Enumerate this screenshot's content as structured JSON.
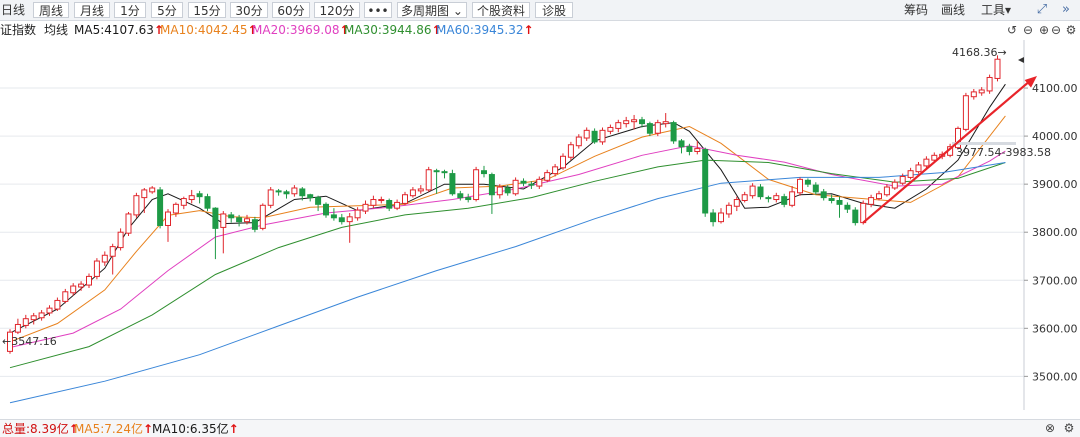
{
  "toolbar": {
    "period_buttons": [
      "日线",
      "周线",
      "月线",
      "1分",
      "5分",
      "15分",
      "30分",
      "60分",
      "120分"
    ],
    "more_label": "•••",
    "multi_period_label": "多周期图",
    "stock_info_label": "个股资料",
    "diagnose_label": "诊股",
    "right_buttons": [
      "筹码",
      "画线",
      "工具"
    ],
    "tools_caret": "▾"
  },
  "indicator_bar": {
    "index_name": "证指数",
    "avg_line_label": "均线",
    "ma": [
      {
        "label": "MA5:4107.63",
        "color": "#1a1a1a"
      },
      {
        "label": "MA10:4042.45",
        "color": "#e8821e"
      },
      {
        "label": "MA20:3969.08",
        "color": "#e040c0"
      },
      {
        "label": "MA30:3944.86",
        "color": "#2f8f2f"
      },
      {
        "label": "MA60:3945.32",
        "color": "#3a86d8"
      }
    ],
    "up_arrow": "↑"
  },
  "volume_bar": {
    "items": [
      {
        "label": "总量:8.39亿",
        "color": "#d01010"
      },
      {
        "label": "MA5:7.24亿",
        "color": "#e8821e"
      },
      {
        "label": "MA10:6.35亿",
        "color": "#1a1a1a"
      }
    ],
    "up_arrow": "↑"
  },
  "colors": {
    "up": "#e0262c",
    "down": "#1e9a46",
    "trend_arrow": "#e8242a",
    "grid": "#e6e9ee"
  },
  "chart_data": {
    "type": "candlestick",
    "y_axis": {
      "min": 3430,
      "max": 4200,
      "ticks": [
        3500,
        3600,
        3700,
        3800,
        3900,
        4000,
        4100
      ],
      "labels": [
        "3500.00",
        "3600.00",
        "3700.00",
        "3800.00",
        "3900.00",
        "4000.00",
        "4100.00"
      ]
    },
    "annotations": {
      "high_label": "4168.36→",
      "low_label": "←3547.16",
      "range_label": "3977.54-3983.58"
    },
    "candles": [
      [
        3552,
        3592,
        3547,
        3598
      ],
      [
        3592,
        3608,
        3588,
        3620
      ],
      [
        3606,
        3620,
        3600,
        3628
      ],
      [
        3618,
        3626,
        3608,
        3632
      ],
      [
        3622,
        3632,
        3616,
        3638
      ],
      [
        3632,
        3642,
        3626,
        3648
      ],
      [
        3640,
        3658,
        3636,
        3664
      ],
      [
        3656,
        3676,
        3652,
        3682
      ],
      [
        3674,
        3688,
        3668,
        3694
      ],
      [
        3686,
        3692,
        3678,
        3698
      ],
      [
        3690,
        3708,
        3684,
        3714
      ],
      [
        3708,
        3740,
        3702,
        3746
      ],
      [
        3738,
        3752,
        3730,
        3760
      ],
      [
        3750,
        3770,
        3712,
        3776
      ],
      [
        3768,
        3800,
        3762,
        3808
      ],
      [
        3798,
        3838,
        3792,
        3842
      ],
      [
        3836,
        3876,
        3830,
        3882
      ],
      [
        3872,
        3888,
        3840,
        3892
      ],
      [
        3884,
        3892,
        3880,
        3896
      ],
      [
        3888,
        3814,
        3808,
        3894
      ],
      [
        3814,
        3842,
        3780,
        3848
      ],
      [
        3840,
        3858,
        3832,
        3862
      ],
      [
        3856,
        3870,
        3848,
        3874
      ],
      [
        3868,
        3876,
        3860,
        3888
      ],
      [
        3880,
        3874,
        3860,
        3886
      ],
      [
        3874,
        3850,
        3844,
        3880
      ],
      [
        3850,
        3808,
        3744,
        3852
      ],
      [
        3810,
        3838,
        3756,
        3844
      ],
      [
        3836,
        3830,
        3820,
        3842
      ],
      [
        3830,
        3822,
        3812,
        3836
      ],
      [
        3822,
        3828,
        3816,
        3836
      ],
      [
        3826,
        3806,
        3800,
        3832
      ],
      [
        3808,
        3856,
        3804,
        3860
      ],
      [
        3856,
        3888,
        3850,
        3894
      ],
      [
        3886,
        3884,
        3876,
        3890
      ],
      [
        3884,
        3880,
        3870,
        3888
      ],
      [
        3880,
        3892,
        3874,
        3898
      ],
      [
        3890,
        3876,
        3866,
        3894
      ],
      [
        3878,
        3872,
        3864,
        3880
      ],
      [
        3872,
        3858,
        3844,
        3876
      ],
      [
        3858,
        3836,
        3830,
        3862
      ],
      [
        3836,
        3830,
        3824,
        3850
      ],
      [
        3830,
        3822,
        3816,
        3838
      ],
      [
        3822,
        3832,
        3778,
        3840
      ],
      [
        3830,
        3846,
        3824,
        3852
      ],
      [
        3844,
        3858,
        3838,
        3866
      ],
      [
        3856,
        3868,
        3850,
        3876
      ],
      [
        3866,
        3868,
        3860,
        3874
      ],
      [
        3866,
        3850,
        3844,
        3870
      ],
      [
        3850,
        3862,
        3846,
        3868
      ],
      [
        3860,
        3878,
        3856,
        3884
      ],
      [
        3876,
        3888,
        3872,
        3894
      ],
      [
        3886,
        3890,
        3880,
        3898
      ],
      [
        3888,
        3930,
        3884,
        3936
      ],
      [
        3928,
        3926,
        3880,
        3932
      ],
      [
        3926,
        3924,
        3912,
        3930
      ],
      [
        3922,
        3880,
        3876,
        3930
      ],
      [
        3880,
        3872,
        3866,
        3886
      ],
      [
        3872,
        3868,
        3862,
        3880
      ],
      [
        3868,
        3930,
        3864,
        3936
      ],
      [
        3928,
        3922,
        3914,
        3938
      ],
      [
        3920,
        3878,
        3838,
        3924
      ],
      [
        3878,
        3894,
        3870,
        3900
      ],
      [
        3892,
        3882,
        3876,
        3898
      ],
      [
        3880,
        3908,
        3876,
        3914
      ],
      [
        3906,
        3902,
        3896,
        3912
      ],
      [
        3900,
        3898,
        3890,
        3906
      ],
      [
        3896,
        3910,
        3890,
        3916
      ],
      [
        3908,
        3924,
        3904,
        3930
      ],
      [
        3922,
        3936,
        3916,
        3942
      ],
      [
        3934,
        3958,
        3930,
        3964
      ],
      [
        3956,
        3982,
        3950,
        3988
      ],
      [
        3980,
        3998,
        3974,
        4004
      ],
      [
        3996,
        4012,
        3990,
        4018
      ],
      [
        4010,
        3988,
        3984,
        4016
      ],
      [
        3988,
        4012,
        3982,
        4018
      ],
      [
        4010,
        4018,
        4004,
        4024
      ],
      [
        4016,
        4028,
        4008,
        4034
      ],
      [
        4026,
        4032,
        4018,
        4040
      ],
      [
        4030,
        4034,
        4014,
        4044
      ],
      [
        4034,
        4026,
        4018,
        4040
      ],
      [
        4026,
        4006,
        4000,
        4030
      ],
      [
        4006,
        4028,
        4000,
        4034
      ],
      [
        4026,
        4030,
        4018,
        4048
      ],
      [
        4028,
        3990,
        3984,
        4032
      ],
      [
        3990,
        3978,
        3964,
        3994
      ],
      [
        3978,
        3968,
        3960,
        3984
      ],
      [
        3968,
        3974,
        3962,
        3990
      ],
      [
        3972,
        3840,
        3832,
        3976
      ],
      [
        3840,
        3822,
        3812,
        3848
      ],
      [
        3822,
        3840,
        3818,
        3850
      ],
      [
        3838,
        3856,
        3830,
        3862
      ],
      [
        3854,
        3868,
        3844,
        3874
      ],
      [
        3866,
        3878,
        3862,
        3884
      ],
      [
        3876,
        3896,
        3870,
        3902
      ],
      [
        3894,
        3874,
        3868,
        3900
      ],
      [
        3872,
        3870,
        3862,
        3876
      ],
      [
        3868,
        3876,
        3862,
        3882
      ],
      [
        3874,
        3858,
        3852,
        3880
      ],
      [
        3856,
        3884,
        3852,
        3896
      ],
      [
        3882,
        3910,
        3876,
        3914
      ],
      [
        3908,
        3900,
        3894,
        3912
      ],
      [
        3898,
        3884,
        3878,
        3904
      ],
      [
        3884,
        3872,
        3866,
        3890
      ],
      [
        3870,
        3866,
        3860,
        3878
      ],
      [
        3866,
        3858,
        3830,
        3874
      ],
      [
        3856,
        3848,
        3840,
        3862
      ],
      [
        3846,
        3820,
        3814,
        3852
      ],
      [
        3820,
        3860,
        3816,
        3866
      ],
      [
        3858,
        3872,
        3852,
        3878
      ],
      [
        3870,
        3880,
        3866,
        3886
      ],
      [
        3878,
        3894,
        3874,
        3900
      ],
      [
        3892,
        3904,
        3888,
        3910
      ],
      [
        3902,
        3916,
        3898,
        3922
      ],
      [
        3914,
        3928,
        3910,
        3934
      ],
      [
        3926,
        3940,
        3922,
        3946
      ],
      [
        3938,
        3952,
        3934,
        3958
      ],
      [
        3950,
        3960,
        3944,
        3966
      ],
      [
        3958,
        3962,
        3952,
        3968
      ],
      [
        3960,
        3978,
        3956,
        3984
      ],
      [
        3976,
        4016,
        3972,
        4020
      ],
      [
        4014,
        4084,
        4010,
        4090
      ],
      [
        4082,
        4092,
        4076,
        4098
      ],
      [
        4090,
        4096,
        4084,
        4102
      ],
      [
        4094,
        4122,
        4088,
        4128
      ],
      [
        4120,
        4160,
        4114,
        4168
      ]
    ],
    "ma_lines": {
      "MA5": [
        [
          0,
          3590
        ],
        [
          6,
          3640
        ],
        [
          12,
          3725
        ],
        [
          15,
          3808
        ],
        [
          18,
          3868
        ],
        [
          20,
          3880
        ],
        [
          24,
          3850
        ],
        [
          27,
          3818
        ],
        [
          31,
          3820
        ],
        [
          36,
          3868
        ],
        [
          40,
          3875
        ],
        [
          44,
          3845
        ],
        [
          50,
          3860
        ],
        [
          55,
          3900
        ],
        [
          60,
          3900
        ],
        [
          65,
          3890
        ],
        [
          70,
          3935
        ],
        [
          74,
          3990
        ],
        [
          80,
          4020
        ],
        [
          84,
          4028
        ],
        [
          86,
          4010
        ],
        [
          90,
          3930
        ],
        [
          93,
          3850
        ],
        [
          96,
          3852
        ],
        [
          100,
          3878
        ],
        [
          104,
          3880
        ],
        [
          108,
          3860
        ],
        [
          112,
          3850
        ],
        [
          116,
          3890
        ],
        [
          120,
          3950
        ],
        [
          124,
          4060
        ],
        [
          126,
          4108
        ]
      ],
      "MA10": [
        [
          0,
          3572
        ],
        [
          6,
          3610
        ],
        [
          12,
          3680
        ],
        [
          16,
          3760
        ],
        [
          20,
          3835
        ],
        [
          24,
          3845
        ],
        [
          28,
          3832
        ],
        [
          32,
          3830
        ],
        [
          38,
          3852
        ],
        [
          44,
          3855
        ],
        [
          50,
          3858
        ],
        [
          56,
          3892
        ],
        [
          62,
          3896
        ],
        [
          68,
          3910
        ],
        [
          74,
          3958
        ],
        [
          80,
          3998
        ],
        [
          86,
          4020
        ],
        [
          90,
          3985
        ],
        [
          96,
          3910
        ],
        [
          102,
          3878
        ],
        [
          108,
          3870
        ],
        [
          114,
          3862
        ],
        [
          120,
          3915
        ],
        [
          126,
          4042
        ]
      ],
      "MA20": [
        [
          0,
          3560
        ],
        [
          8,
          3590
        ],
        [
          14,
          3640
        ],
        [
          20,
          3720
        ],
        [
          26,
          3790
        ],
        [
          32,
          3815
        ],
        [
          40,
          3840
        ],
        [
          48,
          3852
        ],
        [
          56,
          3868
        ],
        [
          64,
          3890
        ],
        [
          72,
          3920
        ],
        [
          80,
          3960
        ],
        [
          86,
          3980
        ],
        [
          92,
          3960
        ],
        [
          98,
          3946
        ],
        [
          104,
          3920
        ],
        [
          112,
          3896
        ],
        [
          118,
          3900
        ],
        [
          124,
          3948
        ],
        [
          126,
          3969
        ]
      ],
      "MA30": [
        [
          0,
          3518
        ],
        [
          10,
          3562
        ],
        [
          18,
          3628
        ],
        [
          26,
          3712
        ],
        [
          34,
          3768
        ],
        [
          42,
          3810
        ],
        [
          50,
          3836
        ],
        [
          58,
          3850
        ],
        [
          66,
          3872
        ],
        [
          74,
          3906
        ],
        [
          82,
          3936
        ],
        [
          88,
          3950
        ],
        [
          96,
          3945
        ],
        [
          104,
          3922
        ],
        [
          112,
          3904
        ],
        [
          120,
          3912
        ],
        [
          126,
          3945
        ]
      ],
      "MA60": [
        [
          0,
          3445
        ],
        [
          12,
          3490
        ],
        [
          24,
          3545
        ],
        [
          34,
          3605
        ],
        [
          44,
          3665
        ],
        [
          54,
          3720
        ],
        [
          64,
          3770
        ],
        [
          74,
          3828
        ],
        [
          82,
          3870
        ],
        [
          90,
          3902
        ],
        [
          100,
          3914
        ],
        [
          110,
          3914
        ],
        [
          118,
          3924
        ],
        [
          126,
          3945
        ]
      ]
    },
    "trend_arrow": {
      "from": [
        108,
        3820
      ],
      "to": [
        130,
        4125
      ]
    }
  }
}
